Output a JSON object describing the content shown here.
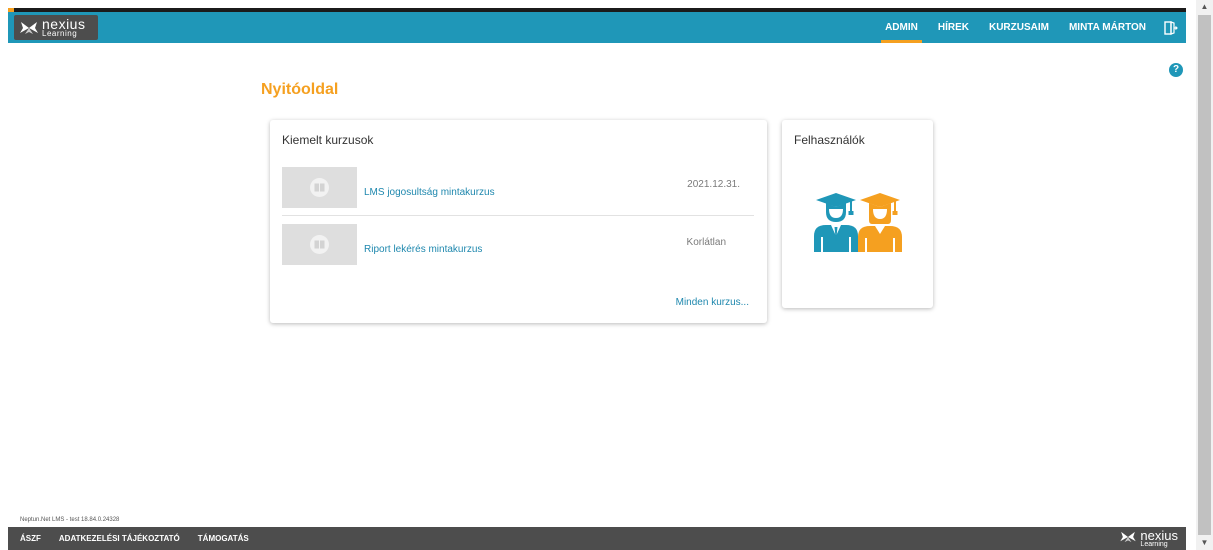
{
  "brand": {
    "logo_line1": "nexius",
    "logo_line2": "Learning",
    "accent_color": "#f5a020",
    "header_color": "#1f97b8",
    "footer_color": "#4d4d4d"
  },
  "nav": {
    "items": [
      {
        "label": "ADMIN",
        "active": true
      },
      {
        "label": "HÍREK",
        "active": false
      },
      {
        "label": "KURZUSAIM",
        "active": false
      },
      {
        "label": "MINTA MÁRTON",
        "active": false
      }
    ],
    "exit_icon": "logout-icon"
  },
  "help_icon": "?",
  "page": {
    "title": "Nyitóoldal"
  },
  "featured": {
    "title": "Kiemelt kurzusok",
    "courses": [
      {
        "name": "LMS jogosultság mintakurzus",
        "date": "2021.12.31."
      },
      {
        "name": "Riport lekérés mintakurzus",
        "date": "Korlátlan"
      }
    ],
    "all_link": "Minden kurzus..."
  },
  "users": {
    "title": "Felhasználók",
    "icon": "graduates-icon"
  },
  "footer": {
    "version": "Neptun.Net LMS - test 18.84.0.24328",
    "links": [
      "ÁSZF",
      "ADATKEZELÉSI TÁJÉKOZTATÓ",
      "TÁMOGATÁS"
    ]
  }
}
